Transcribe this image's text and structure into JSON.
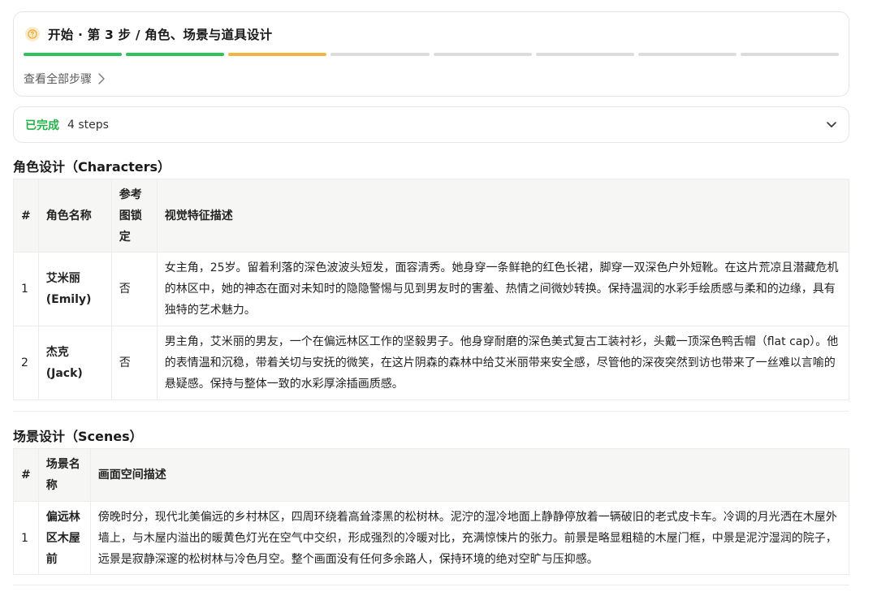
{
  "step": {
    "title": "开始 · 第 3 步 / 角色、场景与道具设计",
    "icon": "question-circle-icon",
    "view_all": "查看全部步骤",
    "progress": [
      "done",
      "done",
      "active",
      "todo",
      "todo",
      "todo",
      "todo",
      "todo"
    ],
    "colors": {
      "done": "#2ec35a",
      "active": "#f2b544",
      "todo": "#dcdcdc"
    }
  },
  "completed": {
    "label": "已完成",
    "count": "4 steps"
  },
  "characters": {
    "heading": "角色设计（Characters）",
    "headers": [
      "#",
      "角色名称",
      "参考图锁定",
      "视觉特征描述"
    ],
    "rows": [
      {
        "num": "1",
        "name": "艾米丽 (Emily)",
        "lock": "否",
        "desc": "女主角，25岁。留着利落的深色波波头短发，面容清秀。她身穿一条鲜艳的红色长裙，脚穿一双深色户外短靴。在这片荒凉且潜藏危机的林区中，她的神态在面对未知时的隐隐警惕与见到男友时的害羞、热情之间微妙转换。保持温润的水彩手绘质感与柔和的边缘，具有独特的艺术魅力。"
      },
      {
        "num": "2",
        "name": "杰克 (Jack)",
        "lock": "否",
        "desc": "男主角，艾米丽的男友，一个在偏远林区工作的坚毅男子。他身穿耐磨的深色美式复古工装衬衫，头戴一顶深色鸭舌帽（flat cap）。他的表情温和沉稳，带着关切与安抚的微笑，在这片阴森的森林中给艾米丽带来安全感，尽管他的深夜突然到访也带来了一丝难以言喻的悬疑感。保持与整体一致的水彩厚涂插画质感。"
      }
    ]
  },
  "scenes": {
    "heading": "场景设计（Scenes）",
    "headers": [
      "#",
      "场景名称",
      "画面空间描述"
    ],
    "rows": [
      {
        "num": "1",
        "name": "偏远林区木屋前",
        "desc": "傍晚时分，现代北美偏远的乡村林区，四周环绕着高耸漆黑的松树林。泥泞的湿冷地面上静静停放着一辆破旧的老式皮卡车。冷调的月光洒在木屋外墙上，与木屋内溢出的暖黄色灯光在空气中交织，形成强烈的冷暖对比，充满惊悚片的张力。前景是略显粗糙的木屋门框，中景是泥泞湿润的院子，远景是寂静深邃的松树林与冷色月空。整个画面没有任何多余路人，保持环境的绝对空旷与压抑感。"
      }
    ]
  }
}
